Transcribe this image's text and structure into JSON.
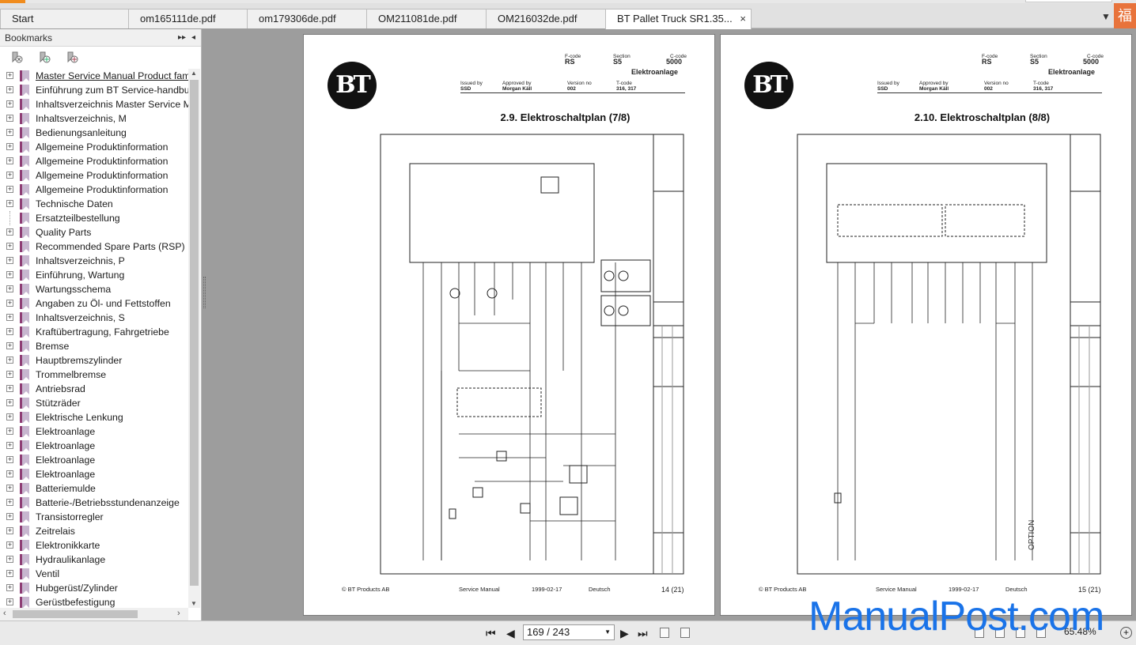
{
  "tabs": [
    {
      "label": "Start",
      "active": false
    },
    {
      "label": "om165111de.pdf",
      "active": false
    },
    {
      "label": "om179306de.pdf",
      "active": false
    },
    {
      "label": "OM211081de.pdf",
      "active": false
    },
    {
      "label": "OM216032de.pdf",
      "active": false
    },
    {
      "label": "BT Pallet Truck SR1.35...",
      "active": true,
      "close": "×"
    }
  ],
  "tab_overflow": "▼",
  "app_corner": "福",
  "sidebar": {
    "title": "Bookmarks",
    "collapse_icon": "▸▸",
    "close_icon": "◂",
    "items": [
      "Master Service Manual Product fam",
      "Einführung zum BT Service-handbu",
      "Inhaltsverzeichnis Master Service M",
      "Inhaltsverzeichnis, M",
      "Bedienungsanleitung",
      "Allgemeine Produktinformation",
      "Allgemeine Produktinformation",
      "Allgemeine Produktinformation",
      "Allgemeine Produktinformation",
      "Technische Daten",
      "Ersatzteilbestellung",
      "Quality Parts",
      "Recommended Spare Parts (RSP)",
      "Inhaltsverzeichnis, P",
      "Einführung, Wartung",
      "Wartungsschema",
      "Angaben zu Öl- und Fettstoffen",
      "Inhaltsverzeichnis, S",
      "Kraftübertragung, Fahrgetriebe",
      "Bremse",
      "Hauptbremszylinder",
      "Trommelbremse",
      "Antriebsrad",
      "Stützräder",
      "Elektrische Lenkung",
      "Elektroanlage",
      "Elektroanlage",
      "Elektroanlage",
      "Elektroanlage",
      "Batteriemulde",
      "Batterie-/Betriebsstundenanzeige",
      "Transistorregler",
      "Zeitrelais",
      "Elektronikkarte",
      "Hydraulikanlage",
      "Ventil",
      "Hubgerüst/Zylinder",
      "Gerüstbefestigung"
    ],
    "no_expander_index": 10
  },
  "pages": [
    {
      "logo": "BT",
      "fcode_label": "F-code",
      "fcode": "RS",
      "section_label": "Section",
      "section": "S5",
      "ccode_label": "C-code",
      "ccode": "5000",
      "subject": "Elektroanlage",
      "issued_label": "Issued by",
      "issued": "SSD",
      "approved_label": "Approved by",
      "approved": "Morgan Käll",
      "version_label": "Version no",
      "version": "002",
      "tcode_label": "T-code",
      "tcode": "316, 317",
      "title": "2.9. Elektroschaltplan (7/8)",
      "footer_company": "© BT Products AB",
      "footer_doc": "Service Manual",
      "footer_date": "1999-02-17",
      "footer_lang": "Deutsch",
      "footer_page": "14 (21)"
    },
    {
      "logo": "BT",
      "fcode_label": "F-code",
      "fcode": "RS",
      "section_label": "Section",
      "section": "S5",
      "ccode_label": "C-code",
      "ccode": "5000",
      "subject": "Elektroanlage",
      "issued_label": "Issued by",
      "issued": "SSD",
      "approved_label": "Approved by",
      "approved": "Morgan Käll",
      "version_label": "Version no",
      "version": "002",
      "tcode_label": "T-code",
      "tcode": "316, 317",
      "title": "2.10. Elektroschaltplan (8/8)",
      "option_label": "OPTION",
      "footer_company": "© BT Products AB",
      "footer_doc": "Service Manual",
      "footer_date": "1999-02-17",
      "footer_lang": "Deutsch",
      "footer_page": "15 (21)"
    }
  ],
  "bottombar": {
    "page_indicator": "169 / 243",
    "zoom": "65.48%"
  },
  "watermark": "ManualPost.com"
}
